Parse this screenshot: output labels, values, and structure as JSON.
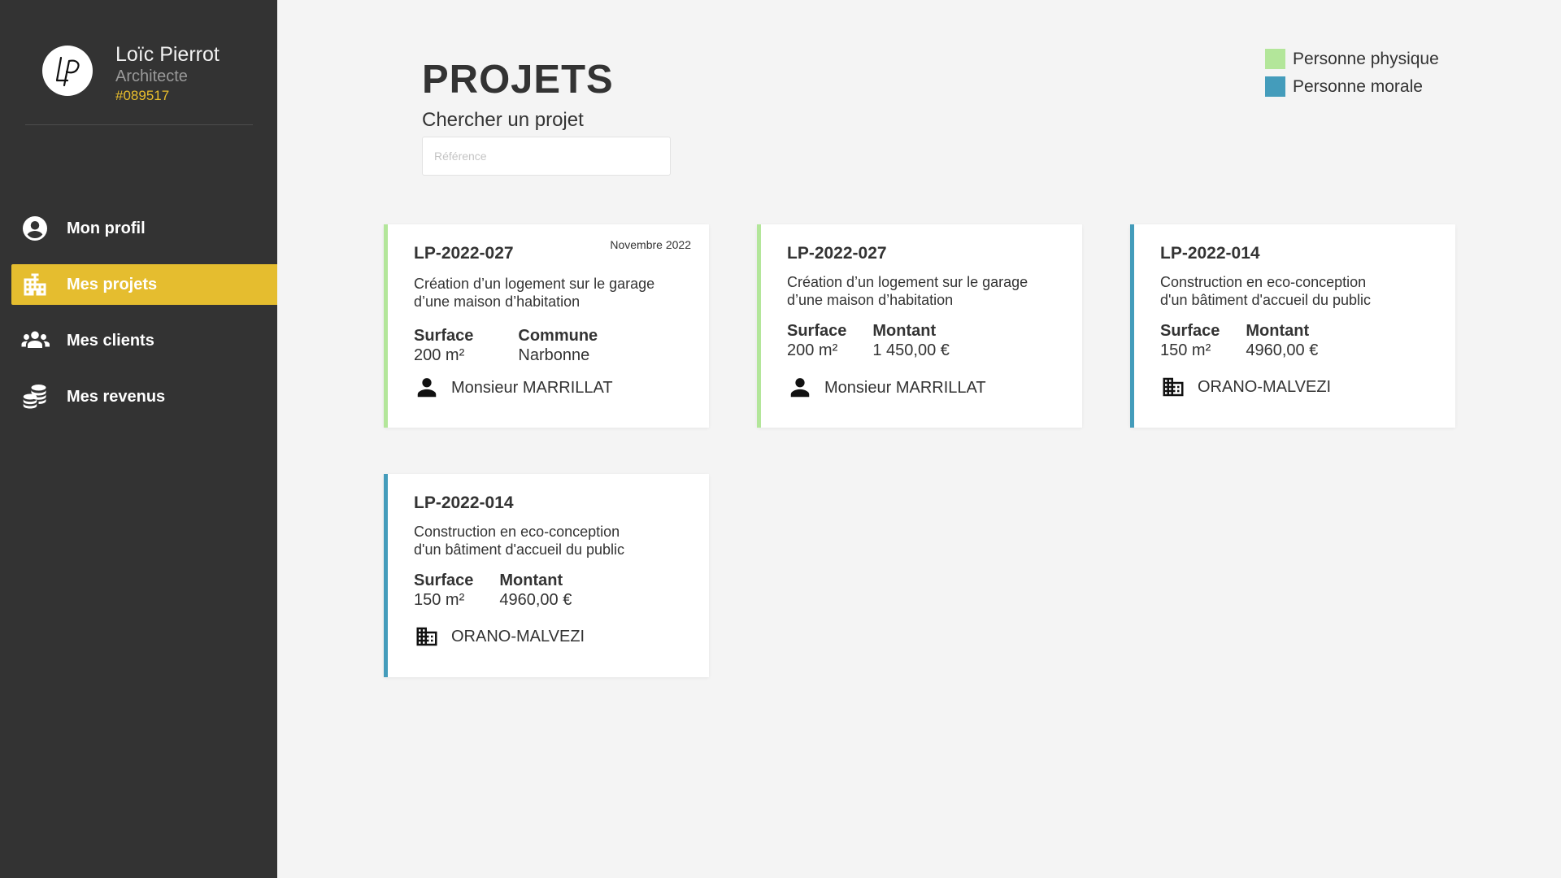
{
  "profile": {
    "name": "Loïc Pierrot",
    "role": "Architecte",
    "id": "#089517"
  },
  "nav": [
    {
      "label": "Mon profil",
      "icon": "user-circle-icon",
      "active": false
    },
    {
      "label": "Mes projets",
      "icon": "buildings-icon",
      "active": true
    },
    {
      "label": "Mes clients",
      "icon": "people-icon",
      "active": false
    },
    {
      "label": "Mes revenus",
      "icon": "coins-icon",
      "active": false
    }
  ],
  "page": {
    "title": "PROJETS",
    "search_label": "Chercher un projet",
    "search_placeholder": "Référence",
    "search_value": ""
  },
  "legend": [
    {
      "label": "Personne physique",
      "color": "#b3e69a"
    },
    {
      "label": "Personne morale",
      "color": "#449cbb"
    }
  ],
  "colors": {
    "sidebar": "#333333",
    "accent": "#e5bd2f",
    "physique": "#b3e69a",
    "morale": "#449cbb"
  },
  "projects": [
    {
      "ref": "LP-2022-027",
      "date": "Novembre 2022",
      "description_line1": "Création d’un logement sur le garage",
      "description_line2": "d’une maison d’habitation",
      "stat1_label": "Surface",
      "stat1_value": "200 m²",
      "stat2_label": "Commune",
      "stat2_value": "Narbonne",
      "client": "Monsieur MARRILLAT",
      "client_type": "physique",
      "client_icon": "person-icon"
    },
    {
      "ref": "LP-2022-027",
      "description_line1": "Création d’un logement sur le garage",
      "description_line2": "d’une maison d’habitation",
      "stat1_label": "Surface",
      "stat1_value": "200 m²",
      "stat2_label": "Montant",
      "stat2_value": "1 450,00 €",
      "client": "Monsieur MARRILLAT",
      "client_type": "physique",
      "client_icon": "person-icon"
    },
    {
      "ref": "LP-2022-014",
      "description_line1": "Construction en eco-conception",
      "description_line2": "d'un bâtiment d'accueil du public",
      "stat1_label": "Surface",
      "stat1_value": "150 m²",
      "stat2_label": "Montant",
      "stat2_value": "4960,00 €",
      "client": "ORANO-MALVEZI",
      "client_type": "morale",
      "client_icon": "building-icon"
    },
    {
      "ref": "LP-2022-014",
      "description_line1": "Construction en eco-conception",
      "description_line2": "d'un bâtiment d'accueil du public",
      "stat1_label": "Surface",
      "stat1_value": "150 m²",
      "stat2_label": "Montant",
      "stat2_value": "4960,00 €",
      "client": "ORANO-MALVEZI",
      "client_type": "morale",
      "client_icon": "building-icon"
    }
  ]
}
